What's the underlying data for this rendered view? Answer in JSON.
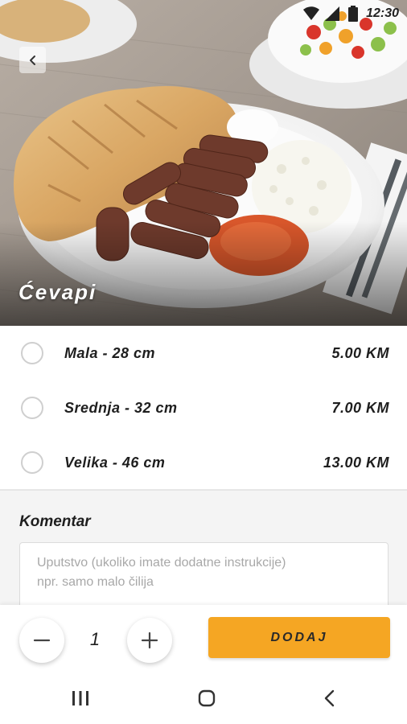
{
  "status_bar": {
    "time": "12:30",
    "icons": [
      "wifi-icon",
      "signal-icon",
      "battery-icon"
    ]
  },
  "hero": {
    "title": "Ćevapi",
    "back_icon": "chevron-left-icon"
  },
  "options": [
    {
      "label": "Mala - 28 cm",
      "price": "5.00 KM",
      "selected": false
    },
    {
      "label": "Srednja - 32 cm",
      "price": "7.00 KM",
      "selected": false
    },
    {
      "label": "Velika - 46 cm",
      "price": "13.00 KM",
      "selected": false
    }
  ],
  "comment": {
    "heading": "Komentar",
    "placeholder": "Uputstvo (ukoliko imate dodatne instrukcije)\nnpr. samo malo čilija",
    "value": ""
  },
  "order": {
    "quantity": "1",
    "add_label": "DODAJ"
  },
  "colors": {
    "accent": "#f5a623",
    "text": "#1e1e1e",
    "placeholder": "#a8a8a8"
  }
}
